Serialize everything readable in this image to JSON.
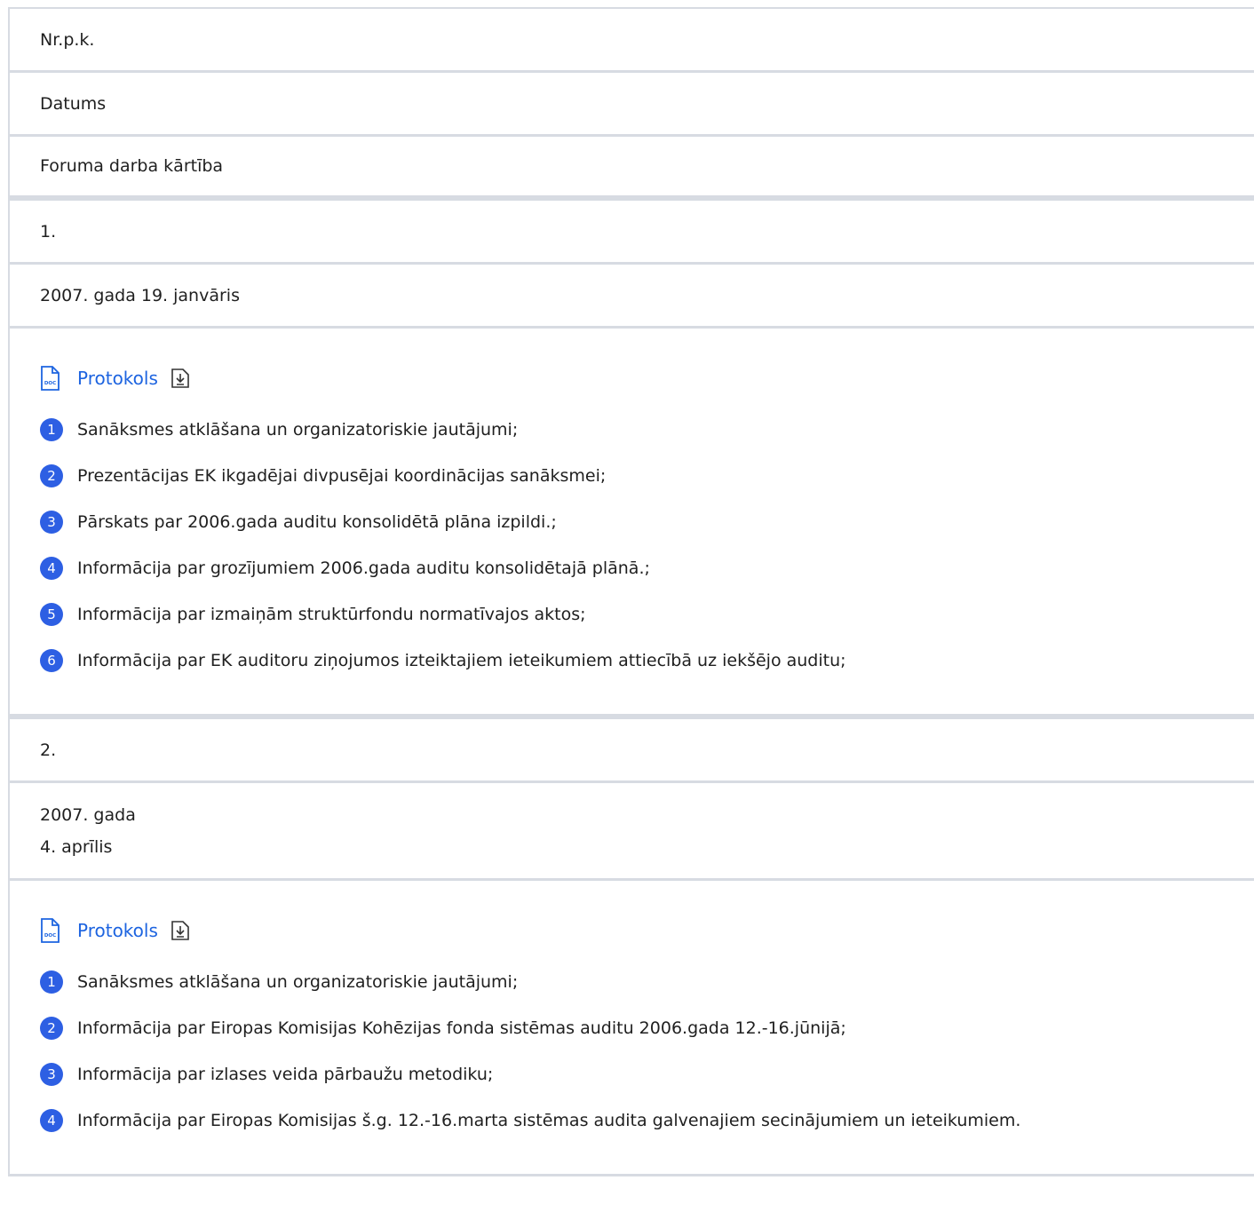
{
  "headers": {
    "col1": "Nr.p.k.",
    "col2": "Datums",
    "col3": "Foruma darba kārtība"
  },
  "entries": [
    {
      "number": "1.",
      "date_line1": "2007. gada 19. janvāris",
      "document": {
        "icon": "doc-file-icon",
        "label": "Protokols",
        "download_icon": "download-icon"
      },
      "items": [
        "Sanāksmes atklāšana un organizatoriskie jautājumi;",
        "Prezentācijas EK ikgadējai divpusējai koordinācijas sanāksmei;",
        "Pārskats par 2006.gada auditu konsolidētā plāna izpildi.;",
        "Informācija par grozījumiem 2006.gada auditu konsolidētajā plānā.;",
        "Informācija par izmaiņām struktūrfondu normatīvajos aktos;",
        "Informācija par EK auditoru ziņojumos izteiktajiem ieteikumiem attiecībā uz iekšējo auditu;"
      ]
    },
    {
      "number": "2.",
      "date_line1": "2007. gada",
      "date_line2": "4. aprīlis",
      "document": {
        "icon": "doc-file-icon",
        "label": "Protokols",
        "download_icon": "download-icon"
      },
      "items": [
        "Sanāksmes atklāšana un organizatoriskie jautājumi;",
        "Informācija par Eiropas Komisijas Kohēzijas fonda sistēmas auditu 2006.gada 12.-16.jūnijā;",
        "Informācija par izlases veida pārbaužu metodiku;",
        "Informācija par Eiropas Komisijas š.g. 12.-16.marta sistēmas audita galvenajiem secinājumiem un ieteikumiem."
      ]
    }
  ],
  "item_numbers": [
    "1",
    "2",
    "3",
    "4",
    "5",
    "6"
  ],
  "colors": {
    "link": "#1d64e0",
    "badge": "#2d5fe3",
    "border": "#d7dbe2"
  }
}
